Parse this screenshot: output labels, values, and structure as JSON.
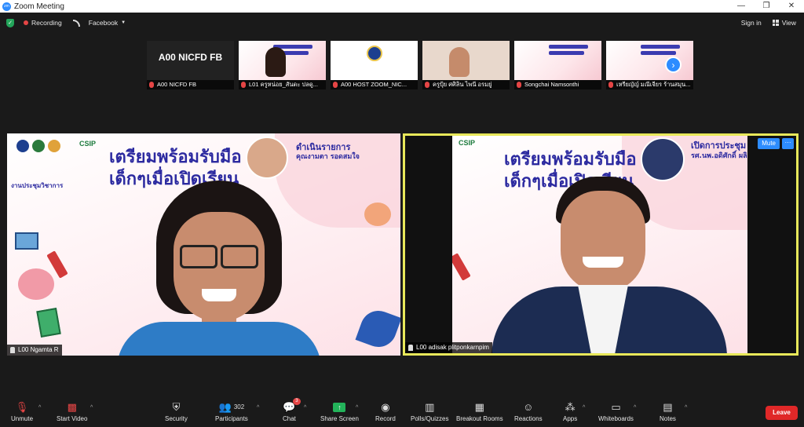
{
  "window": {
    "title": "Zoom Meeting"
  },
  "topbar": {
    "recording": "Recording",
    "livestream": "Facebook",
    "signin": "Sign in",
    "view": "View"
  },
  "thumbnails": [
    {
      "label": "A00 NICFD FB",
      "bigname": "A00 NICFD FB"
    },
    {
      "label": "L01 ครูหน่อย_สันดะ ปลดู..."
    },
    {
      "label": "A00 HOST ZOOM_NIC..."
    },
    {
      "label": "ครูปุ้ย ศศิลิน ไพนี อรมยู่"
    },
    {
      "label": "Songchai Namsonthi"
    },
    {
      "label": "เหรียญัญ์ มณีเจียร ร้านสมุน..."
    }
  ],
  "left_tile": {
    "slide_title_1": "เตรียมพร้อมรับมือ",
    "slide_title_2": "เด็กๆเมื่อเปิดเรียน",
    "role": "ดำเนินรายการ",
    "host_name": "คุณงามตา รอดสมใจ",
    "csip": "CSIP",
    "event": "งานประชุมวิชาการ",
    "participant": "L00 Ngamta R"
  },
  "right_tile": {
    "slide_title_1": "เตรียมพร้อมรับมือ",
    "slide_title_2": "เด็กๆเมื่อเปิดเรียน",
    "role": "เปิดการประชุม",
    "host_name": "รศ.นพ.อดิศักดิ์ ผลิ",
    "csip": "CSIP",
    "participant": "L00 adisak plitponkarnpim",
    "mute": "Mute",
    "more": "···"
  },
  "toolbar": {
    "unmute": "Unmute",
    "start_video": "Start Video",
    "security": "Security",
    "participants": "Participants",
    "participants_count": "302",
    "chat": "Chat",
    "chat_badge": "3",
    "share_screen": "Share Screen",
    "record": "Record",
    "polls": "Polls/Quizzes",
    "breakout": "Breakout Rooms",
    "reactions": "Reactions",
    "apps": "Apps",
    "whiteboards": "Whiteboards",
    "notes": "Notes",
    "leave": "Leave"
  }
}
